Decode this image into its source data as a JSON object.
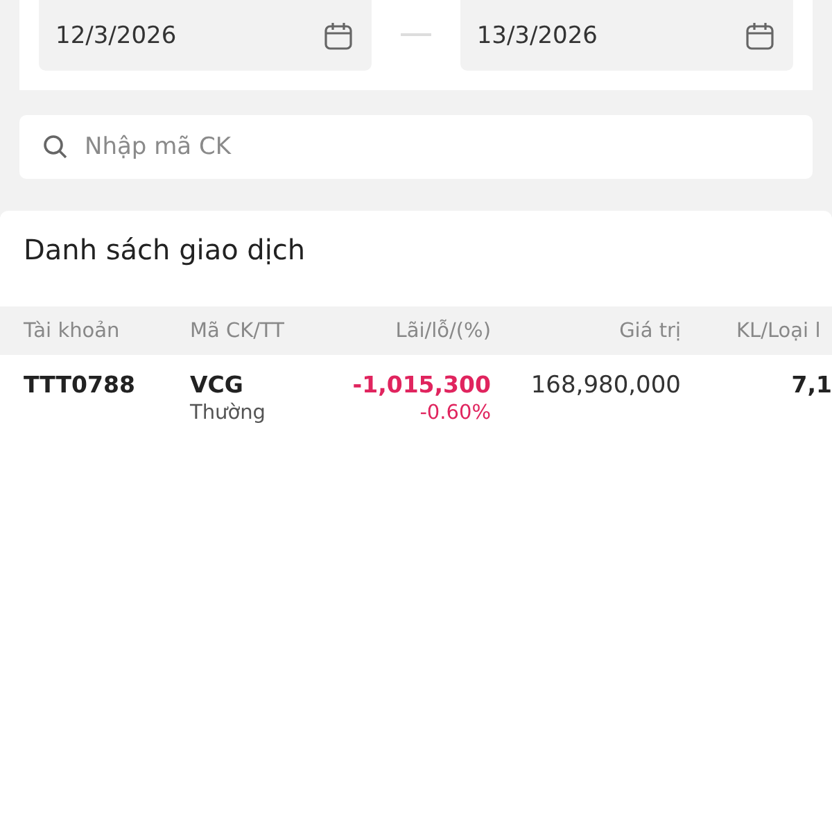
{
  "date_range": {
    "from": "12/3/2026",
    "to": "13/3/2026"
  },
  "search": {
    "placeholder": "Nhập mã CK"
  },
  "transactions": {
    "title": "Danh sách giao dịch",
    "columns": [
      "Tài khoản",
      "Mã CK/TT",
      "Lãi/lỗ/(%)",
      "Giá trị",
      "KL/Loại l"
    ],
    "rows": [
      {
        "account": "TTT0788",
        "symbol": "VCG",
        "order_type": "Thường",
        "pnl": "-1,015,300",
        "pnl_percent": "-0.60%",
        "negative": true,
        "value": "168,980,000",
        "volume": "7,1"
      }
    ]
  }
}
